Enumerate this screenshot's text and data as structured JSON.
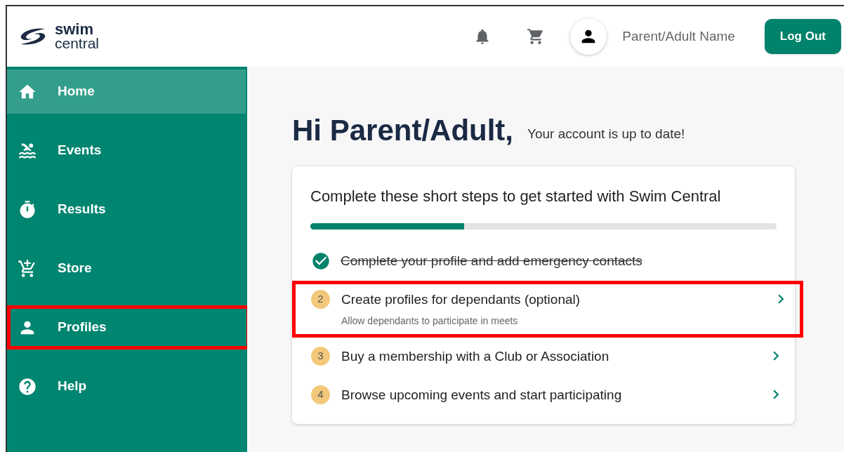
{
  "logo": {
    "line_1": "swim",
    "line_2": "central"
  },
  "header": {
    "user_name": "Parent/Adult Name",
    "logout_button": "Log Out"
  },
  "sidebar": {
    "items": [
      {
        "label": "Home",
        "selected": true,
        "highlighted": false
      },
      {
        "label": "Events",
        "selected": false,
        "highlighted": false
      },
      {
        "label": "Results",
        "selected": false,
        "highlighted": false
      },
      {
        "label": "Store",
        "selected": false,
        "highlighted": false
      },
      {
        "label": "Profiles",
        "selected": false,
        "highlighted": true
      },
      {
        "label": "Help",
        "selected": false,
        "highlighted": false
      }
    ]
  },
  "greeting": {
    "title": "Hi Parent/Adult,",
    "status": "Your account is up to date!"
  },
  "steps_card": {
    "title": "Complete these short steps to get started with Swim Central",
    "progress": {
      "level": 0.33
    },
    "steps": [
      {
        "title": "Complete your profile and add emergency contacts",
        "completed": true,
        "highlighted": false
      },
      {
        "number": "2",
        "title": "Create profiles for dependants (optional)",
        "subtitle": "Allow dependants to participate in meets",
        "completed": false,
        "highlighted": true
      },
      {
        "number": "3",
        "title": "Buy a membership with a Club or Association",
        "completed": false,
        "highlighted": false
      },
      {
        "number": "4",
        "title": "Browse upcoming events and start participating",
        "completed": false,
        "highlighted": false
      }
    ]
  }
}
